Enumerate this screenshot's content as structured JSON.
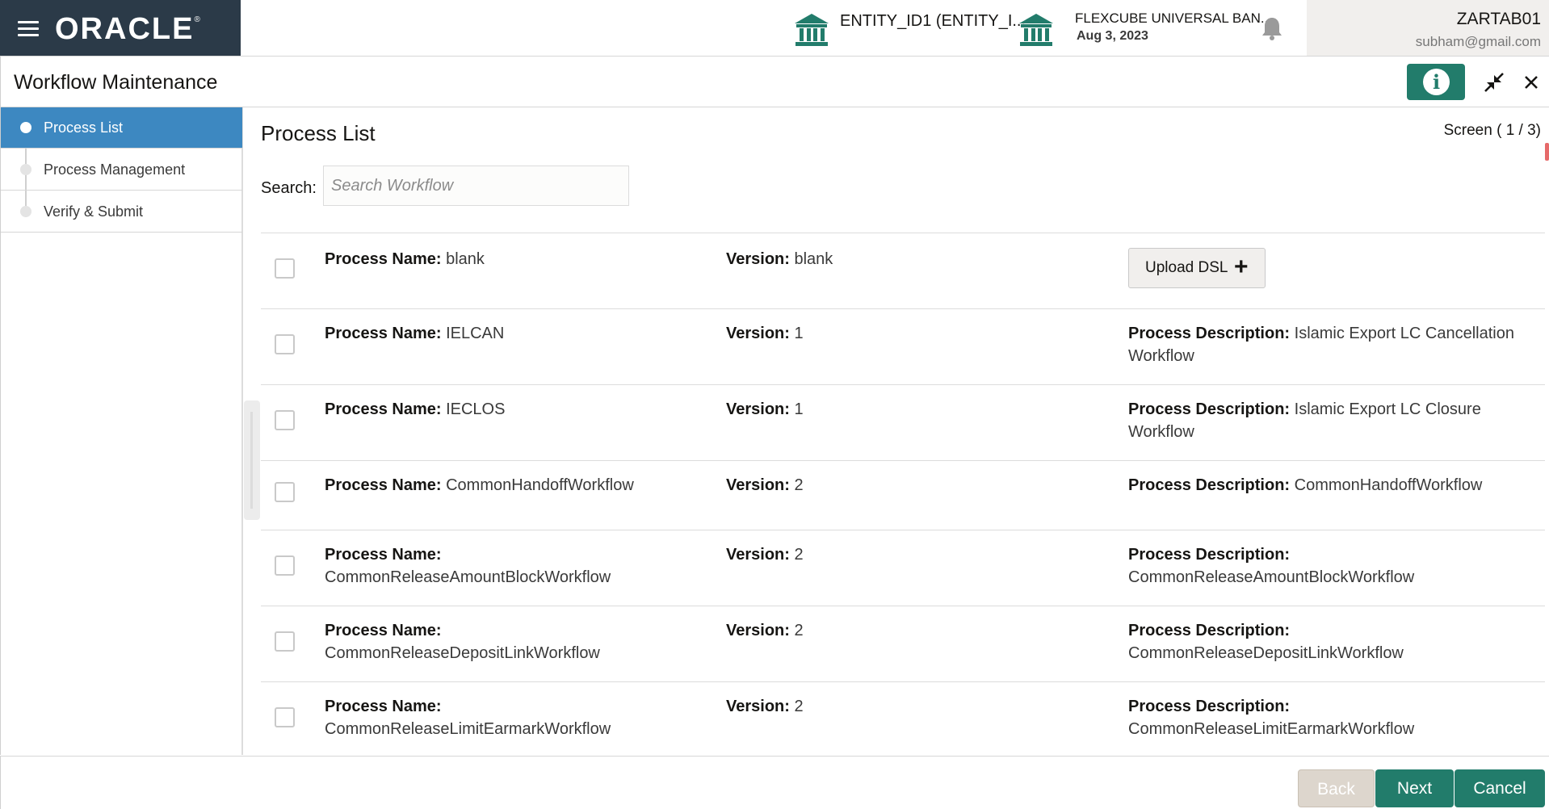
{
  "topbar": {
    "logo": "ORACLE",
    "entity_label": "ENTITY_ID1  (ENTITY_I...",
    "bank_name": "FLEXCUBE UNIVERSAL BAN...",
    "bank_date": "Aug 3, 2023",
    "user_id": "ZARTAB01",
    "user_email": "subham@gmail.com"
  },
  "window": {
    "title": "Workflow Maintenance",
    "info_glyph": "i"
  },
  "sidebar": {
    "steps": [
      {
        "label": "Process List",
        "active": true
      },
      {
        "label": "Process Management",
        "active": false
      },
      {
        "label": "Verify & Submit",
        "active": false
      }
    ]
  },
  "main": {
    "title": "Process List",
    "screen_info": "Screen ( 1 / 3)",
    "search_label": "Search:",
    "search_placeholder": "Search Workflow",
    "search_value": "",
    "name_label": "Process Name:",
    "version_label": "Version:",
    "desc_label": "Process Description:",
    "upload_label": "Upload DSL",
    "upload_plus": "+",
    "rows": [
      {
        "name": "blank",
        "version": "blank",
        "description": ""
      },
      {
        "name": "IELCAN",
        "version": "1",
        "description": "Islamic Export LC Cancellation Workflow"
      },
      {
        "name": "IECLOS",
        "version": "1",
        "description": "Islamic Export LC Closure Workflow"
      },
      {
        "name": "CommonHandoffWorkflow",
        "version": "2",
        "description": "CommonHandoffWorkflow"
      },
      {
        "name": "CommonReleaseAmountBlockWorkflow",
        "version": "2",
        "description": "CommonReleaseAmountBlockWorkflow"
      },
      {
        "name": "CommonReleaseDepositLinkWorkflow",
        "version": "2",
        "description": "CommonReleaseDepositLinkWorkflow"
      },
      {
        "name": "CommonReleaseLimitEarmarkWorkflow",
        "version": "2",
        "description": "CommonReleaseLimitEarmarkWorkflow"
      }
    ]
  },
  "footer": {
    "back_label": "Back",
    "next_label": "Next",
    "cancel_label": "Cancel"
  },
  "colors": {
    "brand_bar": "#2b3a48",
    "accent_teal": "#227c6b",
    "active_step": "#3d88c1"
  },
  "icons": {
    "menu": "hamburger-icon",
    "entity": "bank-icon",
    "notifications": "bell-icon",
    "info": "info-icon",
    "minimize": "minimize-icon",
    "close": "close-icon",
    "add": "plus-icon"
  }
}
